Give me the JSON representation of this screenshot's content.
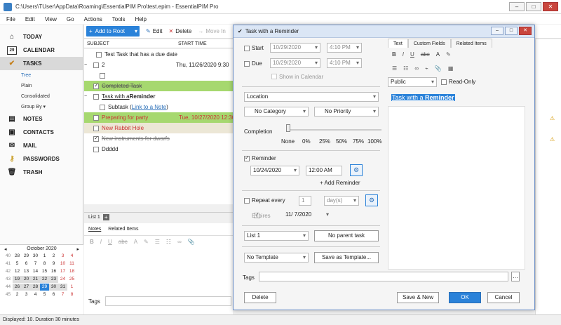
{
  "window": {
    "title": "C:\\Users\\TUser\\AppData\\Roaming\\EssentialPIM Pro\\test.epim - EssentialPIM Pro"
  },
  "menu": [
    "File",
    "Edit",
    "View",
    "Go",
    "Actions",
    "Tools",
    "Help"
  ],
  "nav": {
    "today": "TODAY",
    "calendar": "CALENDAR",
    "tasks": "TASKS",
    "sub": [
      "Tree",
      "Plain",
      "Consolidated"
    ],
    "group_by": "Group By",
    "notes": "NOTES",
    "contacts": "CONTACTS",
    "mail": "MAIL",
    "passwords": "PASSWORDS",
    "trash": "TRASH",
    "calendar_day_label": "29"
  },
  "calendar": {
    "month": "October  2020",
    "rows": [
      [
        "40",
        "28",
        "29",
        "30",
        "1",
        "2",
        "3",
        "4"
      ],
      [
        "41",
        "5",
        "6",
        "7",
        "8",
        "9",
        "10",
        "11"
      ],
      [
        "42",
        "12",
        "13",
        "14",
        "15",
        "16",
        "17",
        "18"
      ],
      [
        "43",
        "19",
        "20",
        "21",
        "22",
        "23",
        "24",
        "25"
      ],
      [
        "44",
        "26",
        "27",
        "28",
        "29",
        "30",
        "31",
        "1"
      ],
      [
        "45",
        "2",
        "3",
        "4",
        "5",
        "6",
        "7",
        "8"
      ]
    ]
  },
  "toolbar": {
    "add": "Add to Root",
    "edit": "Edit",
    "delete": "Delete",
    "move": "Move In"
  },
  "list": {
    "col_subject": "SUBJECT",
    "col_start": "START TIME",
    "rows": [
      {
        "text": "Test Task that has a due date",
        "start": ""
      },
      {
        "text": "2",
        "start": "Thu, 11/26/2020 9:30"
      },
      {
        "text": "",
        "start": ""
      },
      {
        "text": "Completed Task",
        "start": ""
      },
      {
        "text": "Task with a ",
        "bold": "Reminder",
        "start": ""
      },
      {
        "text": "Subtask (",
        "link": "Link to a Note",
        "after": ")",
        "start": ""
      },
      {
        "text": "Preparing for party",
        "start": "Tue, 10/27/2020 12:30"
      },
      {
        "text": "New Rabbit Hole",
        "start": ""
      },
      {
        "text": "New instruments for dwarfs",
        "start": ""
      },
      {
        "text": "Ddddd",
        "start": ""
      }
    ]
  },
  "lists_tab": "List 1",
  "bottom_tabs": {
    "notes": "Notes",
    "related": "Related Items"
  },
  "tags_label": "Tags",
  "status": "Displayed: 10. Duration 30 minutes",
  "dialog": {
    "title": "Task with a Reminder",
    "start_label": "Start",
    "start_date": "10/29/2020",
    "start_time": "4:10 PM",
    "due_label": "Due",
    "due_date": "10/29/2020",
    "due_time": "4:10 PM",
    "show_in_calendar": "Show in Calendar",
    "location": "Location",
    "category": "No Category",
    "priority": "No Priority",
    "completion_label": "Completion",
    "completion_ticks": [
      "None",
      "0%",
      "25%",
      "50%",
      "75%",
      "100%"
    ],
    "reminder_label": "Reminder",
    "reminder_date": "10/24/2020",
    "reminder_time": "12:00 AM",
    "add_reminder": "+ Add Reminder",
    "repeat_label": "Repeat every",
    "repeat_n": "1",
    "repeat_unit": "day(s)",
    "expires_label": "Expires",
    "expires_date": "11/ 7/2020",
    "list": "List 1",
    "parent": "No parent task",
    "template": "No Template",
    "save_template": "Save as Template...",
    "tags_label": "Tags",
    "delete": "Delete",
    "save_new": "Save & New",
    "ok": "OK",
    "cancel": "Cancel",
    "tabs": [
      "Text",
      "Custom Fields",
      "Related Items"
    ],
    "privacy": "Public",
    "readonly": "Read-Only",
    "editor_text": "Task with a ",
    "editor_bold": "Reminder"
  }
}
